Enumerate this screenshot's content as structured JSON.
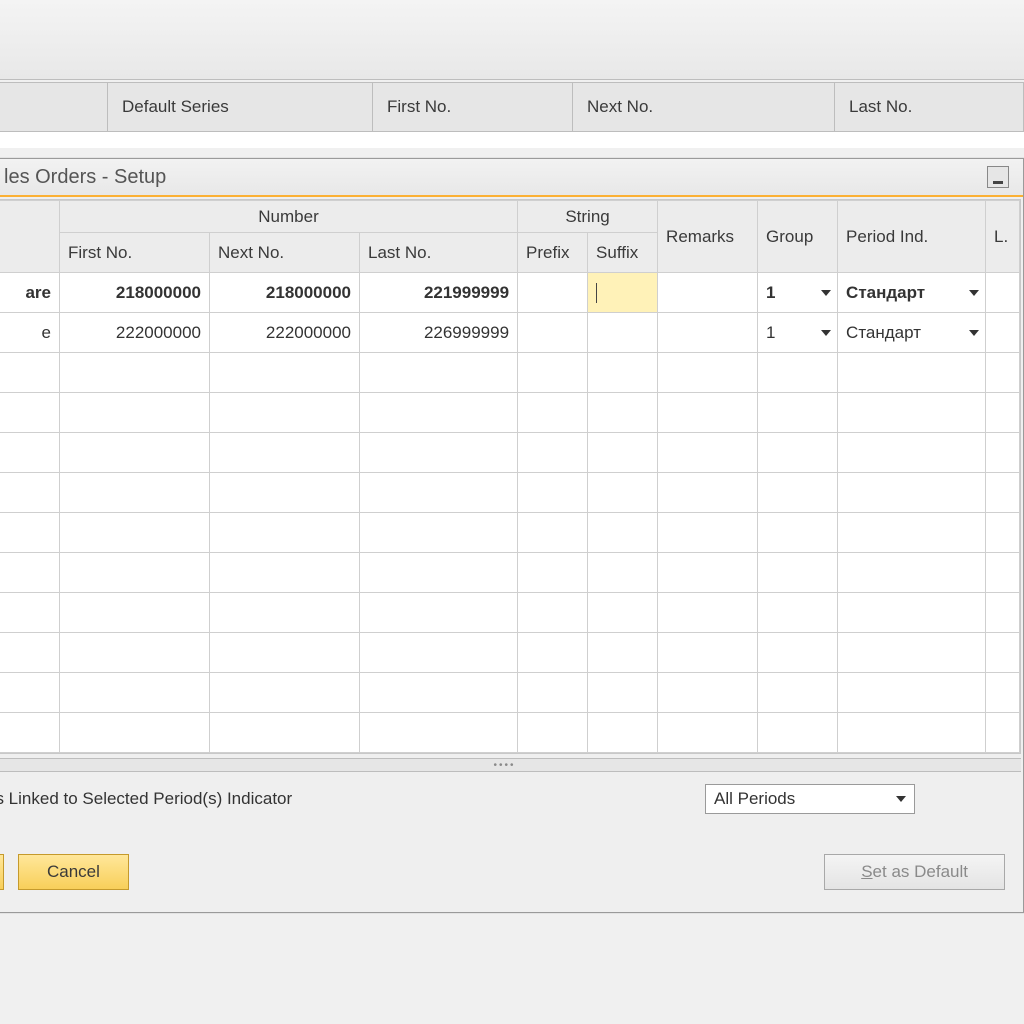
{
  "background": {
    "headers": [
      "Default Series",
      "First No.",
      "Next No.",
      "Last No."
    ]
  },
  "modal": {
    "title": "les Orders - Setup",
    "columns": {
      "number_group": "Number",
      "string_group": "String",
      "name": "",
      "first_no": "First No.",
      "next_no": "Next No.",
      "last_no": "Last No.",
      "prefix": "Prefix",
      "suffix": "Suffix",
      "remarks": "Remarks",
      "group": "Group",
      "period_ind": "Period Ind.",
      "last_col": "L."
    },
    "rows": [
      {
        "name": "are",
        "first_no": "218000000",
        "next_no": "218000000",
        "last_no": "221999999",
        "prefix": "",
        "suffix": "",
        "remarks": "",
        "group": "1",
        "period_ind": "Стандарт",
        "active": true
      },
      {
        "name": "e",
        "first_no": "222000000",
        "next_no": "222000000",
        "last_no": "226999999",
        "prefix": "",
        "suffix": "",
        "remarks": "",
        "group": "1",
        "period_ind": "Стандарт",
        "active": false
      }
    ],
    "footer": {
      "label": "es Linked to Selected Period(s) Indicator",
      "select_value": "All Periods"
    },
    "buttons": {
      "cancel": "Cancel",
      "set_default_prefix": "S",
      "set_default_rest": "et as Default"
    }
  }
}
